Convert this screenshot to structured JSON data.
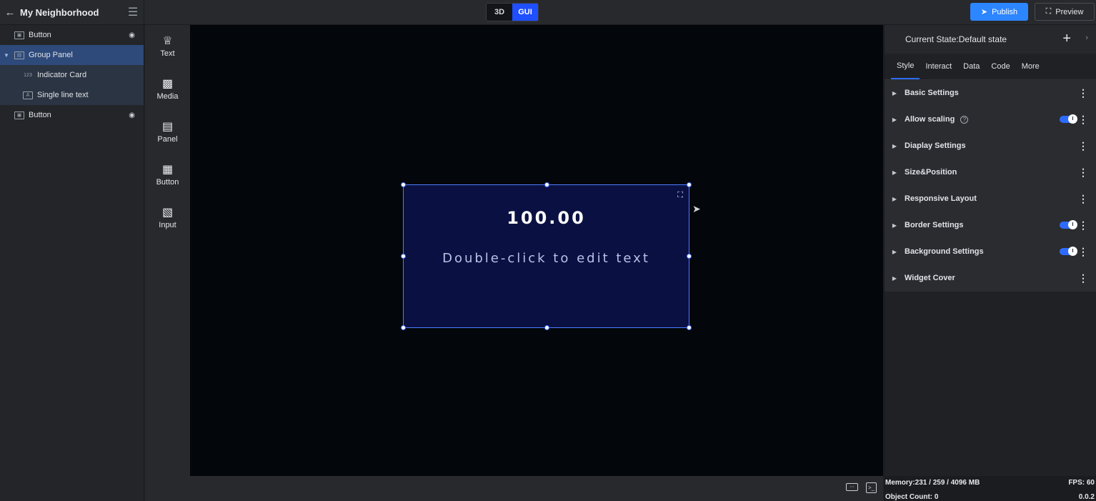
{
  "header": {
    "title": "My Neighborhood",
    "mode_3d": "3D",
    "mode_gui": "GUI",
    "publish_label": "Publish",
    "preview_label": "Preview"
  },
  "layers": {
    "items": [
      {
        "label": "Button"
      },
      {
        "label": "Group Panel"
      },
      {
        "label": "Indicator Card"
      },
      {
        "label": "Single line text"
      },
      {
        "label": "Button"
      }
    ]
  },
  "palette": {
    "items": [
      {
        "label": "Text"
      },
      {
        "label": "Media"
      },
      {
        "label": "Panel"
      },
      {
        "label": "Button"
      },
      {
        "label": "Input"
      }
    ]
  },
  "widget": {
    "value": "100.00",
    "subtitle": "Double-click to edit text"
  },
  "right_panel": {
    "state": "Current State:Default state",
    "tabs": [
      {
        "label": "Style"
      },
      {
        "label": "Interact"
      },
      {
        "label": "Data"
      },
      {
        "label": "Code"
      },
      {
        "label": "More"
      }
    ],
    "sections": [
      {
        "label": "Basic Settings"
      },
      {
        "label": "Allow scaling"
      },
      {
        "label": "Diaplay Settings"
      },
      {
        "label": "Size&Position"
      },
      {
        "label": "Responsive Layout"
      },
      {
        "label": "Border Settings"
      },
      {
        "label": "Background Settings"
      },
      {
        "label": "Widget Cover"
      }
    ]
  },
  "status": {
    "memory": "Memory:231 / 259 / 4096 MB",
    "objects": "Object Count: 0",
    "fps": "FPS: 60",
    "frame": "0.0.2"
  },
  "colors": {
    "accent": "#2d6bff",
    "publish": "#2c86ff",
    "widget_bg": "#0a1142",
    "canvas_bg": "#03060a"
  }
}
